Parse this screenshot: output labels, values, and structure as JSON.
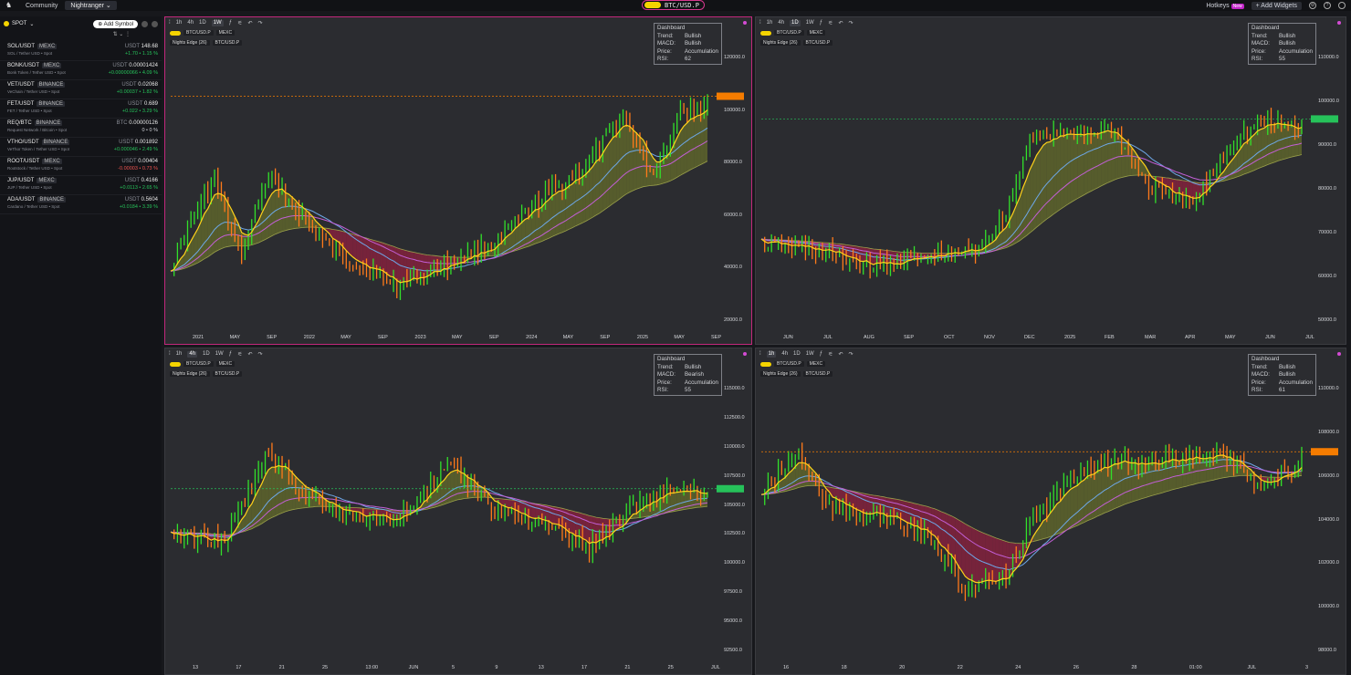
{
  "topbar": {
    "community": "Community",
    "user": "Nightranger",
    "ticker": "BTC/USD.P",
    "hotkeys": "Hotkeys",
    "new_badge": "New",
    "add_widgets": "+ Add Widgets"
  },
  "sidebar": {
    "spot_label": "SPOT",
    "add_symbol": "Add Symbol",
    "items": [
      {
        "sym": "SOL/USDT",
        "exch": "MEXC",
        "desc": "SOL / Tether USD • Spot",
        "cur": "USDT",
        "price": "148.68",
        "chg": "+1.70 • 1.15 %",
        "dir": "up"
      },
      {
        "sym": "BONK/USDT",
        "exch": "MEXC",
        "desc": "Bonk Token / Tether USD • Spot",
        "cur": "USDT",
        "price": "0.00001424",
        "chg": "+0.00000066 • 4.09 %",
        "dir": "up"
      },
      {
        "sym": "VET/USDT",
        "exch": "BINANCE",
        "desc": "VeChain / Tether USD • Spot",
        "cur": "USDT",
        "price": "0.02068",
        "chg": "+0.00037 • 1.82 %",
        "dir": "up"
      },
      {
        "sym": "FET/USDT",
        "exch": "BINANCE",
        "desc": "FET / Tether USD • Spot",
        "cur": "USDT",
        "price": "0.689",
        "chg": "+0.022 • 3.29 %",
        "dir": "up"
      },
      {
        "sym": "REQ/BTC",
        "exch": "BINANCE",
        "desc": "Request Network / Bitcoin • Spot",
        "cur": "BTC",
        "price": "0.00000126",
        "chg": "0 • 0 %",
        "dir": "flat"
      },
      {
        "sym": "VTHO/USDT",
        "exch": "BINANCE",
        "desc": "VeThor Token / Tether USD • Spot",
        "cur": "USDT",
        "price": "0.001892",
        "chg": "+0.000046 • 2.49 %",
        "dir": "up"
      },
      {
        "sym": "ROOT/USDT",
        "exch": "MEXC",
        "desc": "Rootstock / Tether USD • Spot",
        "cur": "USDT",
        "price": "0.00404",
        "chg": "-0.00003 • 0.73 %",
        "dir": "down"
      },
      {
        "sym": "JUP/USDT",
        "exch": "MEXC",
        "desc": "JUP / Tether USD • Spot",
        "cur": "USDT",
        "price": "0.4166",
        "chg": "+0.0113 • 2.65 %",
        "dir": "up"
      },
      {
        "sym": "ADA/USDT",
        "exch": "BINANCE",
        "desc": "Cardano / Tether USD • Spot",
        "cur": "USDT",
        "price": "0.5604",
        "chg": "+0.0184 • 3.39 %",
        "dir": "up"
      }
    ]
  },
  "panels": [
    {
      "timeframes": [
        "1h",
        "4h",
        "1D",
        "1W"
      ],
      "active_tf": "1W",
      "symbol": "BTC/USD.P",
      "exchange": "MEXC",
      "indicator": "Nights Edge (26)",
      "indicator_sym": "BTC/USD.P",
      "dashboard": {
        "title": "Dashboard",
        "trend": "Bullish",
        "macd": "Bullish",
        "price": "Accumulation",
        "rsi": "62"
      },
      "yticks": [
        "120000.0",
        "100000.0",
        "80000.0",
        "60000.0",
        "40000.0",
        "20000.0"
      ],
      "xticks": [
        "2021",
        "MAY",
        "SEP",
        "2022",
        "MAY",
        "SEP",
        "2023",
        "MAY",
        "SEP",
        "2024",
        "MAY",
        "SEP",
        "2025",
        "MAY",
        "SEP"
      ],
      "price_color": "#f57c00"
    },
    {
      "timeframes": [
        "1h",
        "4h",
        "1D",
        "1W"
      ],
      "active_tf": "1D",
      "symbol": "BTC/USD.P",
      "exchange": "MEXC",
      "indicator": "Nights Edge (26)",
      "indicator_sym": "BTC/USD.P",
      "dashboard": {
        "title": "Dashboard",
        "trend": "Bullish",
        "macd": "Bullish",
        "price": "Accumulation",
        "rsi": "55"
      },
      "yticks": [
        "110000.0",
        "100000.0",
        "90000.0",
        "80000.0",
        "70000.0",
        "60000.0",
        "50000.0"
      ],
      "xticks": [
        "JUN",
        "JUL",
        "AUG",
        "SEP",
        "OCT",
        "NOV",
        "DEC",
        "2025",
        "FEB",
        "MAR",
        "APR",
        "MAY",
        "JUN",
        "JUL"
      ],
      "price_color": "#26c25a"
    },
    {
      "timeframes": [
        "1h",
        "4h",
        "1D",
        "1W"
      ],
      "active_tf": "4h",
      "symbol": "BTC/USD.P",
      "exchange": "MEXC",
      "indicator": "Nights Edge (26)",
      "indicator_sym": "BTC/USD.P",
      "dashboard": {
        "title": "Dashboard",
        "trend": "Bullish",
        "macd": "Bearish",
        "price": "Accumulation",
        "rsi": "55"
      },
      "yticks": [
        "115000.0",
        "112500.0",
        "110000.0",
        "107500.0",
        "105000.0",
        "102500.0",
        "100000.0",
        "97500.0",
        "95000.0",
        "92500.0"
      ],
      "xticks": [
        "13",
        "17",
        "21",
        "25",
        "13:00",
        "JUN",
        "5",
        "9",
        "13",
        "17",
        "21",
        "25",
        "JUL"
      ],
      "price_color": "#26c25a"
    },
    {
      "timeframes": [
        "1h",
        "4h",
        "1D",
        "1W"
      ],
      "active_tf": "1h",
      "symbol": "BTC/USD.P",
      "exchange": "MEXC",
      "indicator": "Nights Edge (26)",
      "indicator_sym": "BTC/USD.P",
      "dashboard": {
        "title": "Dashboard",
        "trend": "Bullish",
        "macd": "Bullish",
        "price": "Accumulation",
        "rsi": "61"
      },
      "yticks": [
        "110000.0",
        "108000.0",
        "106000.0",
        "104000.0",
        "102000.0",
        "100000.0",
        "98000.0"
      ],
      "xticks": [
        "16",
        "18",
        "20",
        "22",
        "24",
        "26",
        "28",
        "01:00",
        "JUL",
        "3"
      ],
      "price_color": "#f57c00"
    }
  ]
}
